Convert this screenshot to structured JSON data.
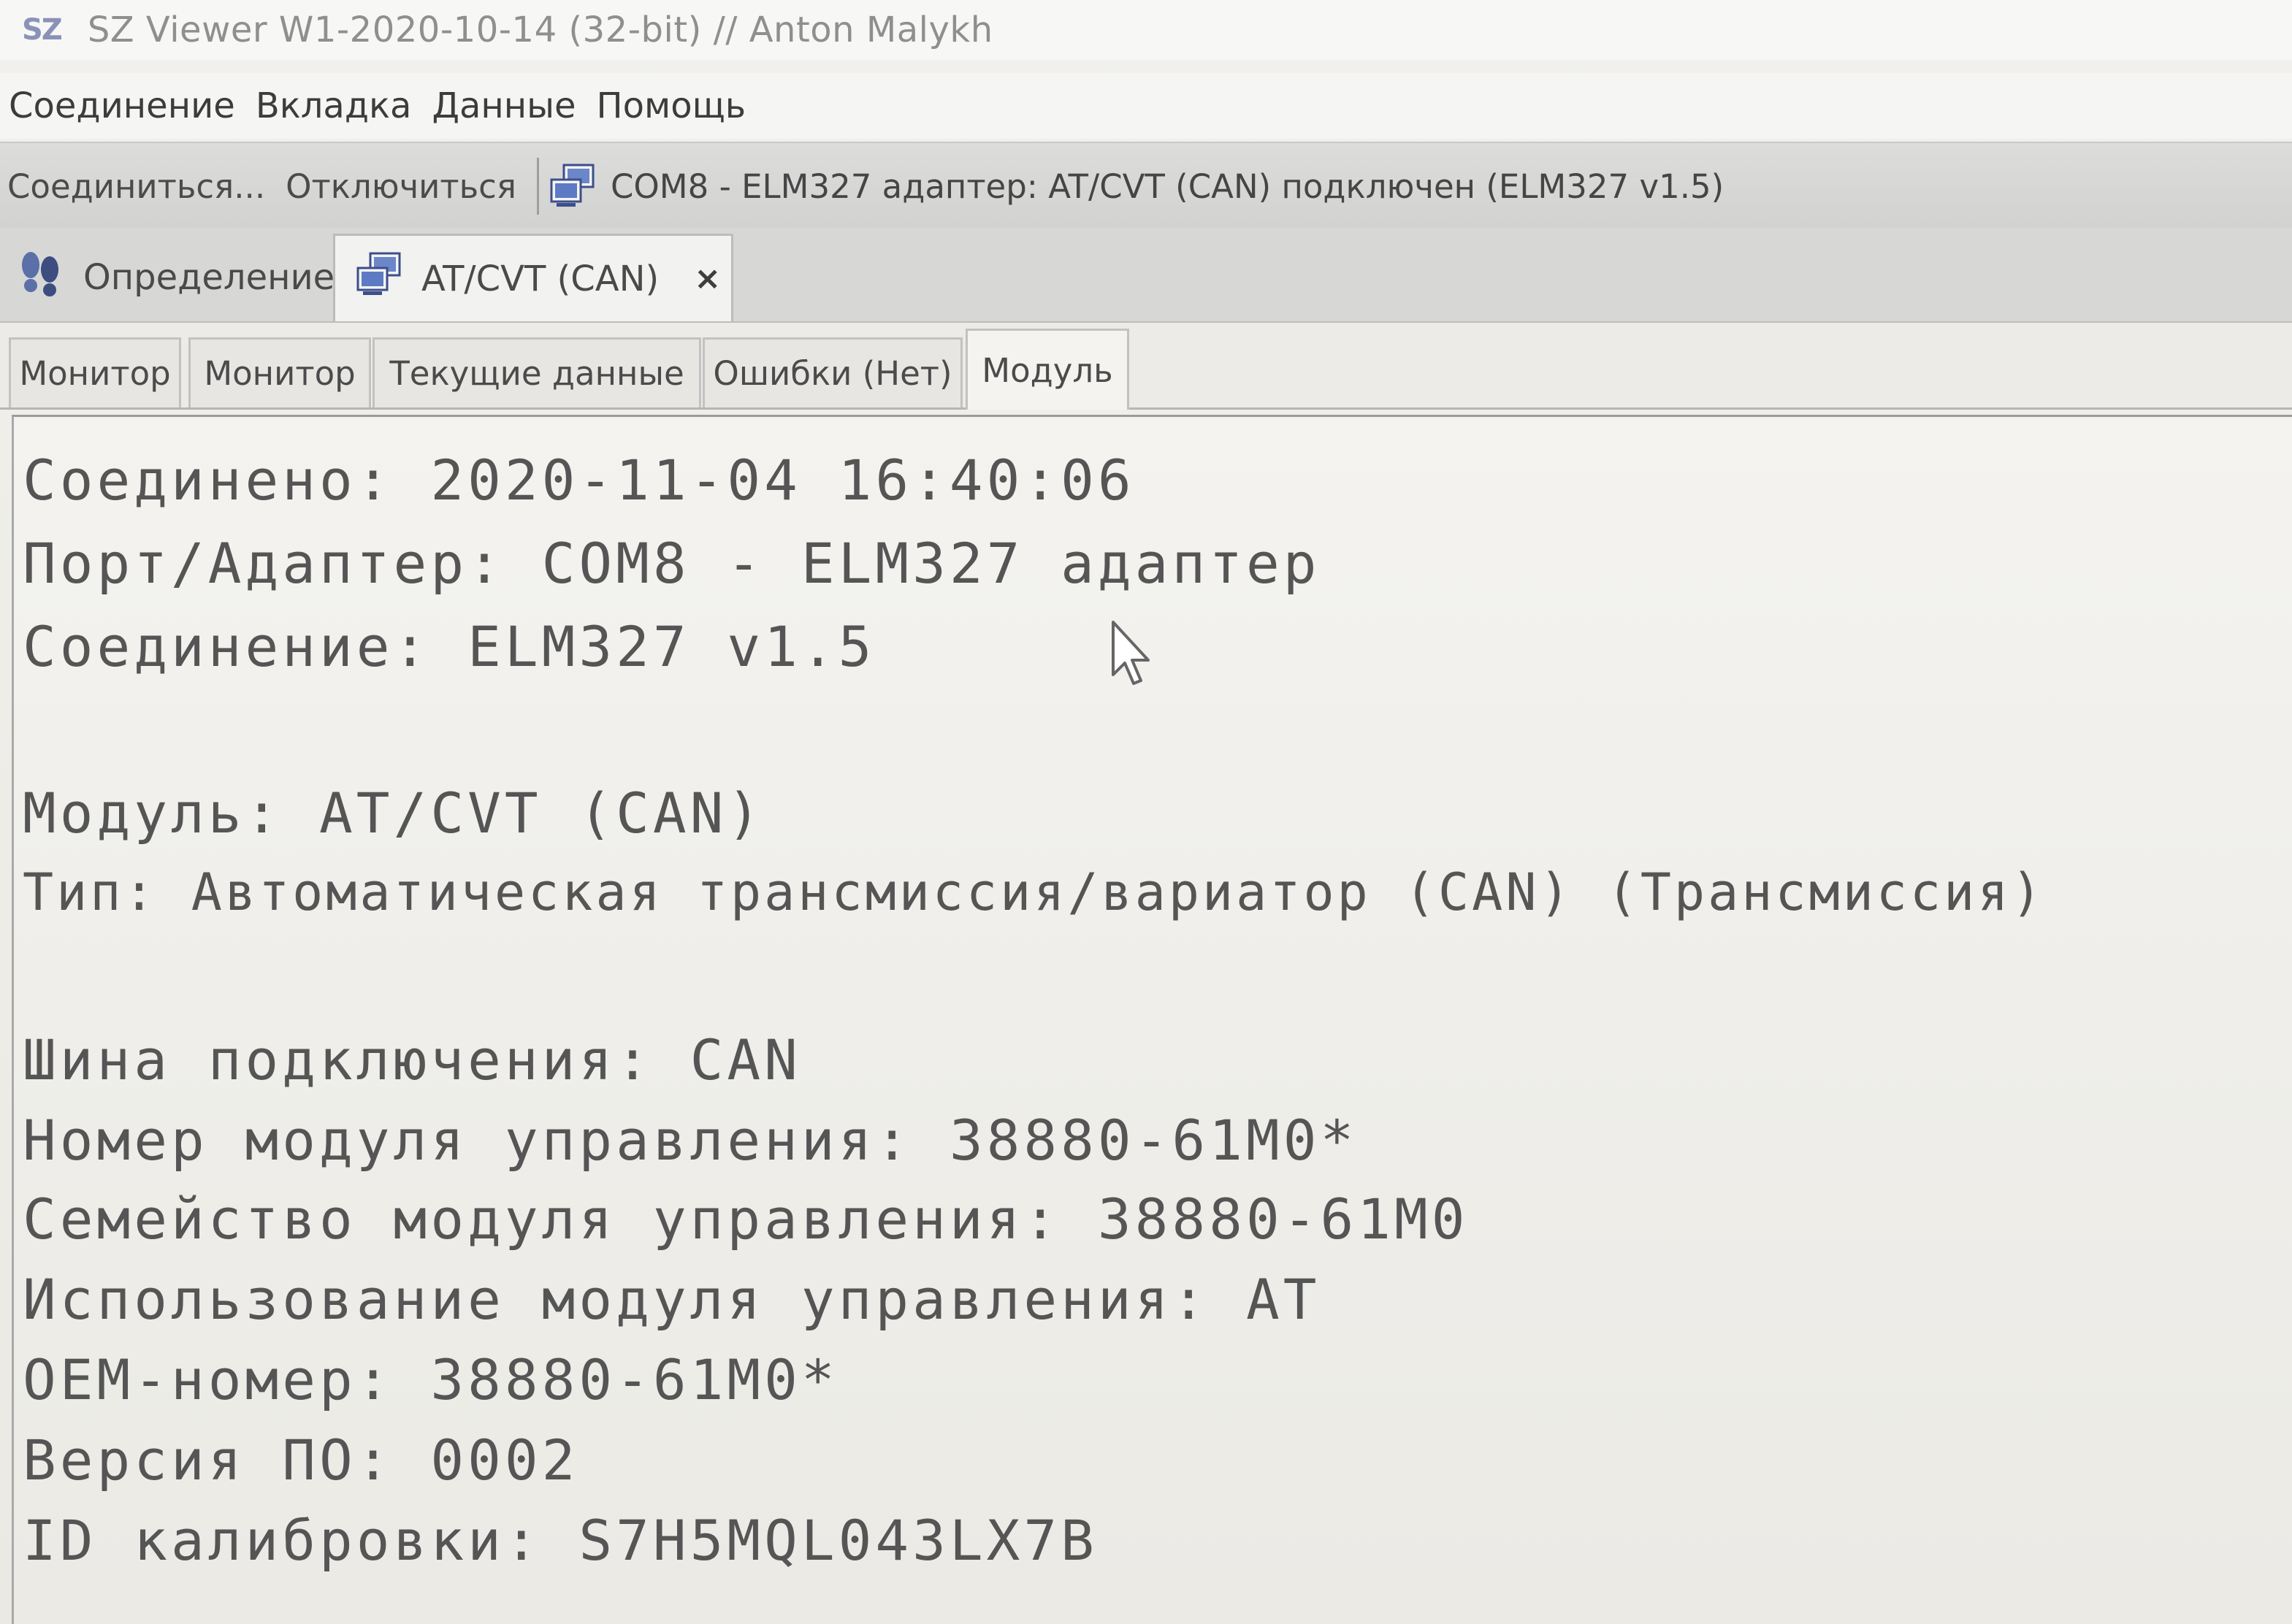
{
  "window": {
    "logo": "SZ",
    "title": "SZ Viewer W1-2020-10-14 (32-bit) // Anton Malykh"
  },
  "menu": [
    "Соединение",
    "Вкладка",
    "Данные",
    "Помощь"
  ],
  "toolbar": {
    "connect_label": "Соединиться...",
    "disconnect_label": "Отключиться",
    "status": "COM8 - ELM327 адаптер: AT/CVT (CAN) подключен (ELM327 v1.5)"
  },
  "doc_tabs": [
    {
      "label": "Определение",
      "icon": "footprints-icon"
    },
    {
      "label": "AT/CVT (CAN)",
      "icon": "network-computers-icon",
      "close": "×"
    }
  ],
  "sub_tabs": [
    {
      "label": "Монитор"
    },
    {
      "label": "Монитор"
    },
    {
      "label": "Текущие данные"
    },
    {
      "label": "Ошибки (Нет)"
    },
    {
      "label": "Модуль"
    }
  ],
  "module_info": [
    "Соединено: 2020-11-04 16:40:06",
    "Порт/Адаптер: COM8 - ELM327 адаптер",
    "Соединение: ELM327 v1.5",
    "",
    "Модуль: AT/CVT (CAN)",
    "Тип: Автоматическая трансмиссия/вариатор (CAN) (Трансмиссия)",
    "",
    "Шина подключения: CAN",
    "Номер модуля управления: 38880-61M0*",
    "Семейство модуля управления: 38880-61M0",
    "Использование модуля управления: AT",
    "OEM-номер: 38880-61M0*",
    "Версия ПО: 0002",
    "ID калибровки: S7H5MQL043LX7B"
  ]
}
